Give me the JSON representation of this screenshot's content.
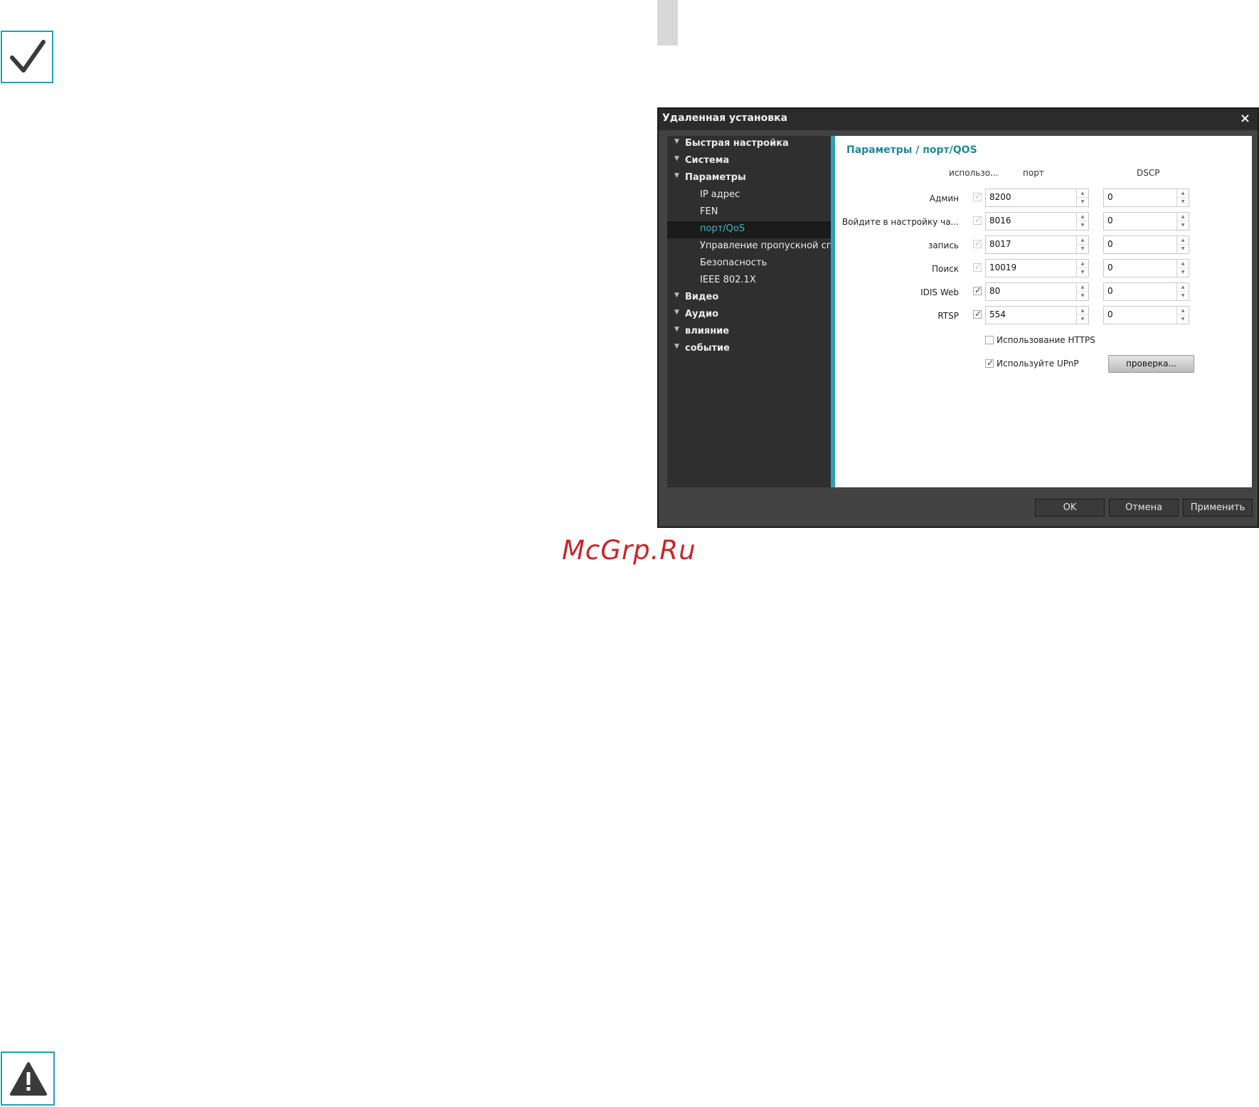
{
  "dialog": {
    "title": "Удаленная установка",
    "close_glyph": "×",
    "tree": [
      {
        "label": "Быстрая настройка",
        "level": "top"
      },
      {
        "label": "Система",
        "level": "top"
      },
      {
        "label": "Параметры",
        "level": "top"
      },
      {
        "label": "IP адрес",
        "level": "sub"
      },
      {
        "label": "FEN",
        "level": "sub"
      },
      {
        "label": "порт/QoS",
        "level": "sub",
        "selected": true
      },
      {
        "label": "Управление пропускной спос",
        "level": "sub"
      },
      {
        "label": "Безопасность",
        "level": "sub"
      },
      {
        "label": "IEEE 802.1X",
        "level": "sub"
      },
      {
        "label": "Видео",
        "level": "top"
      },
      {
        "label": "Аудио",
        "level": "top"
      },
      {
        "label": "влияние",
        "level": "top"
      },
      {
        "label": "событие",
        "level": "top"
      }
    ],
    "content": {
      "heading": "Параметры / порт/QOS",
      "col_use": "использо...",
      "col_port": "порт",
      "col_dscp": "DSCP",
      "rows": [
        {
          "label": "Админ",
          "use": true,
          "use_enabled": false,
          "port": "8200",
          "dscp": "0"
        },
        {
          "label": "Войдите в настройку ча...",
          "use": true,
          "use_enabled": false,
          "port": "8016",
          "dscp": "0"
        },
        {
          "label": "запись",
          "use": true,
          "use_enabled": false,
          "port": "8017",
          "dscp": "0"
        },
        {
          "label": "Поиск",
          "use": true,
          "use_enabled": false,
          "port": "10019",
          "dscp": "0"
        },
        {
          "label": "IDIS Web",
          "use": true,
          "use_enabled": true,
          "port": "80",
          "dscp": "0"
        },
        {
          "label": "RTSP",
          "use": true,
          "use_enabled": true,
          "port": "554",
          "dscp": "0"
        }
      ],
      "https": {
        "label": "Использование HTTPS",
        "checked": false
      },
      "upnp": {
        "label": "Используйте UPnP",
        "checked": true
      },
      "check_button": "проверка..."
    },
    "buttons": {
      "ok": "OK",
      "cancel": "Отмена",
      "apply": "Применить"
    }
  },
  "watermark": "McGrp.Ru",
  "colors": {
    "accent": "#1ea3b3",
    "heading": "#1e8a9b",
    "selected_text": "#34b9c8",
    "watermark": "#c9262a"
  }
}
